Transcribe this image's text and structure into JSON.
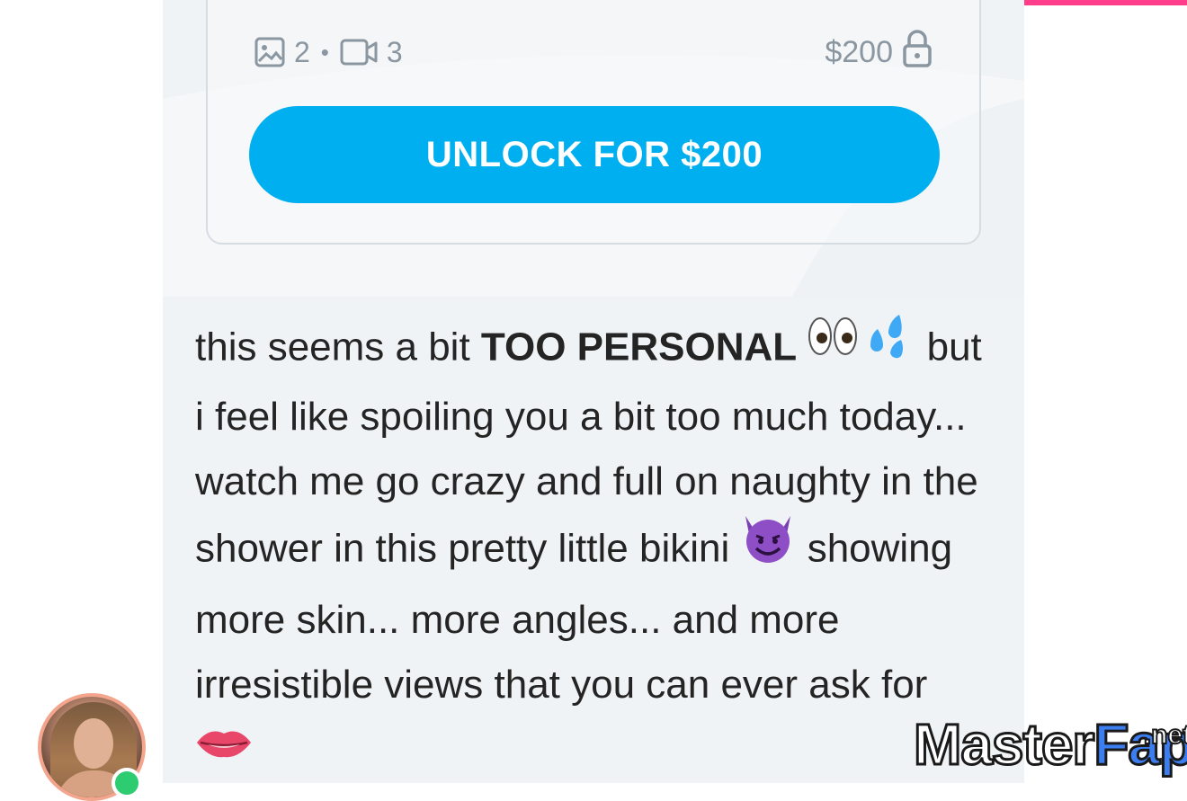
{
  "colors": {
    "accent": "#00aff0",
    "top_bar": "#ff3d8b",
    "online": "#2ecc71",
    "muted": "#8a96a0"
  },
  "post": {
    "media_counts": {
      "photos_icon": "image-icon",
      "photos": "2",
      "separator": "•",
      "videos_icon": "video-icon",
      "videos": "3"
    },
    "price": "$200",
    "price_icon": "lock-icon",
    "unlock_label": "UNLOCK FOR $200"
  },
  "message": {
    "part1": "this seems a bit ",
    "bold": "TOO PERSONAL",
    "emoji1": "👀💦",
    "part2": " but i feel like spoiling you a bit too much today... watch me go crazy and full on naughty in the shower in this pretty little bikini ",
    "emoji2": "😈",
    "part3": " showing more skin... more angles... and more irresistible views that you can ever ask for ",
    "emoji3": "👄"
  },
  "avatar": {
    "status": "online"
  },
  "watermark": {
    "part1": "Master",
    "part2": "Fap",
    "suffix": ".net"
  }
}
